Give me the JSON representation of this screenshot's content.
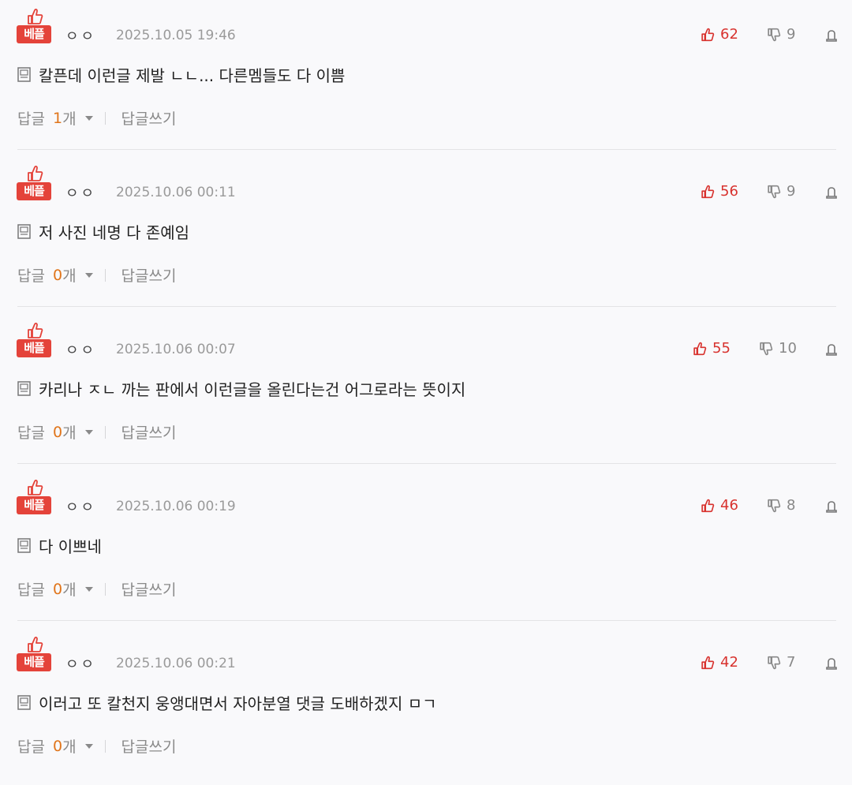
{
  "badge_label": "베플",
  "reply_label": "답글",
  "reply_unit": "개",
  "write_reply_label": "답글쓰기",
  "colors": {
    "accent_red": "#e4433a",
    "reply_count": "#e0751b"
  },
  "comments": [
    {
      "author": "ㅇㅇ",
      "date": "2025.10.05 19:46",
      "text": "칼픈데 이런글 제발 ㄴㄴ... 다른멤들도 다 이쁨",
      "likes": "62",
      "dislikes": "9",
      "replies": "1"
    },
    {
      "author": "ㅇㅇ",
      "date": "2025.10.06 00:11",
      "text": "저 사진 네명 다 존예임",
      "likes": "56",
      "dislikes": "9",
      "replies": "0"
    },
    {
      "author": "ㅇㅇ",
      "date": "2025.10.06 00:07",
      "text": "카리나 ㅈㄴ 까는 판에서 이런글을 올린다는건 어그로라는 뜻이지",
      "likes": "55",
      "dislikes": "10",
      "replies": "0"
    },
    {
      "author": "ㅇㅇ",
      "date": "2025.10.06 00:19",
      "text": "다 이쁘네",
      "likes": "46",
      "dislikes": "8",
      "replies": "0"
    },
    {
      "author": "ㅇㅇ",
      "date": "2025.10.06 00:21",
      "text": "이러고 또 칼천지 웅앵대면서 자아분열 댓글 도배하겠지 ㅁㄱ",
      "likes": "42",
      "dislikes": "7",
      "replies": "0"
    }
  ]
}
